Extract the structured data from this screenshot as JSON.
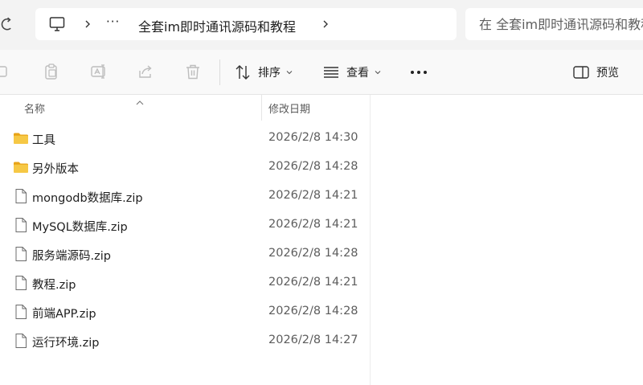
{
  "address_bar": {
    "overflow_label": "···",
    "current_folder": "全套im即时通讯源码和教程",
    "search_placeholder": "在 全套im即时通讯源码和教程 中搜索"
  },
  "toolbar": {
    "sort_label": "排序",
    "view_label": "查看",
    "more_label": "•••",
    "preview_label": "预览"
  },
  "columns": {
    "name": "名称",
    "date_modified": "修改日期"
  },
  "files": [
    {
      "name": "工具",
      "date": "2026/2/8 14:30",
      "type": "folder"
    },
    {
      "name": "另外版本",
      "date": "2026/2/8 14:28",
      "type": "folder"
    },
    {
      "name": "mongodb数据库.zip",
      "date": "2026/2/8 14:21",
      "type": "file"
    },
    {
      "name": "MySQL数据库.zip",
      "date": "2026/2/8 14:21",
      "type": "file"
    },
    {
      "name": "服务端源码.zip",
      "date": "2026/2/8 14:28",
      "type": "file"
    },
    {
      "name": "教程.zip",
      "date": "2026/2/8 14:21",
      "type": "file"
    },
    {
      "name": "前端APP.zip",
      "date": "2026/2/8 14:28",
      "type": "file"
    },
    {
      "name": "运行环境.zip",
      "date": "2026/2/8 14:27",
      "type": "file"
    }
  ],
  "colors": {
    "folder": "#f6c845",
    "folder_dark": "#e8a317",
    "address_bg": "#f3f3f3",
    "toolbar_bg": "#f9f9f9"
  }
}
